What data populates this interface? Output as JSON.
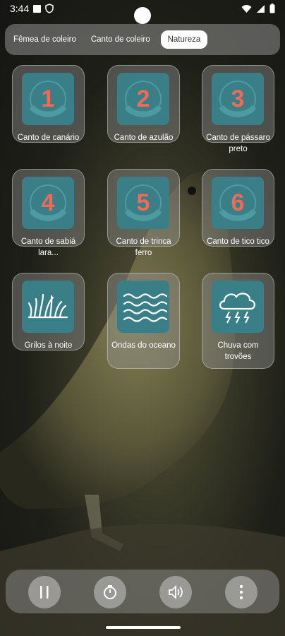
{
  "status": {
    "time": "3:44"
  },
  "tabs": [
    {
      "label": "Fêmea de coleiro",
      "active": false
    },
    {
      "label": "Canto de coleiro",
      "active": false
    },
    {
      "label": "Natureza",
      "active": true
    }
  ],
  "sounds": [
    {
      "number": "1",
      "label": "Canto de canário",
      "icon": "number-badge-icon"
    },
    {
      "number": "2",
      "label": "Canto de azulão",
      "icon": "number-badge-icon"
    },
    {
      "number": "3",
      "label": "Canto de pássaro preto",
      "icon": "number-badge-icon"
    },
    {
      "number": "4",
      "label": "Canto de sabiá lara...",
      "icon": "number-badge-icon"
    },
    {
      "number": "5",
      "label": "Canto de trinca ferro",
      "icon": "number-badge-icon"
    },
    {
      "number": "6",
      "label": "Canto de tico tico",
      "icon": "number-badge-icon"
    },
    {
      "label": "Grilos à noite",
      "icon": "grass-icon"
    },
    {
      "label": "Ondas do oceano",
      "icon": "waves-icon"
    },
    {
      "label": "Chuva com trovões",
      "icon": "storm-cloud-icon"
    }
  ],
  "player": {
    "buttons": [
      "pause-icon",
      "timer-icon",
      "volume-icon",
      "more-vertical-icon"
    ]
  },
  "colors": {
    "icon_bg": "#3a7f87",
    "number": "#f26a55"
  }
}
